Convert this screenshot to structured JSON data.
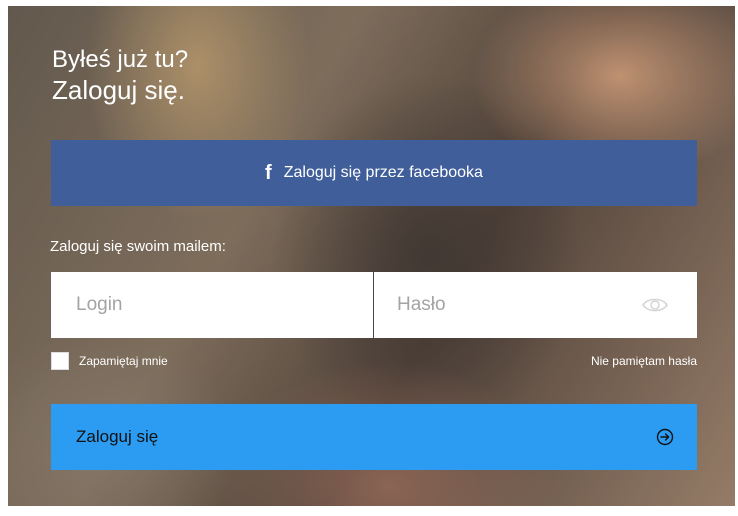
{
  "heading": {
    "line1": "Byłeś już tu?",
    "line2": "Zaloguj się."
  },
  "facebook_button": {
    "icon": "f",
    "label": "Zaloguj się przez facebooka",
    "color": "#3f5e9a"
  },
  "email_label": "Zaloguj się swoim mailem:",
  "login_field": {
    "placeholder": "Login",
    "value": ""
  },
  "password_field": {
    "placeholder": "Hasło",
    "value": ""
  },
  "remember_me": {
    "label": "Zapamiętaj mnie",
    "checked": false
  },
  "forgot_password": "Nie pamiętam hasła",
  "submit_button": {
    "label": "Zaloguj się",
    "color": "#2b9cf2"
  },
  "icons": {
    "password_toggle": "eye-icon",
    "submit": "arrow-circle-right-icon"
  }
}
